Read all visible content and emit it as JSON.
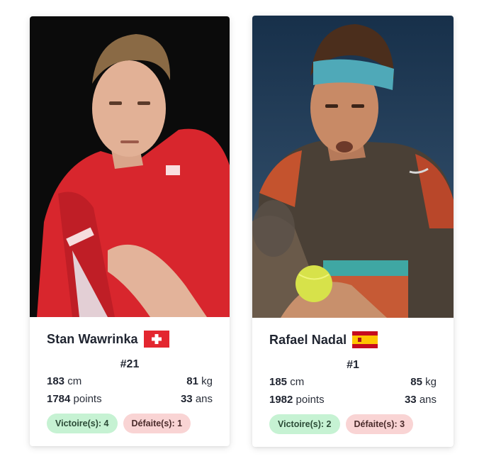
{
  "players": [
    {
      "name": "Stan Wawrinka",
      "flag": "switzerland-flag",
      "rank": "#21",
      "height_value": "183",
      "height_unit": "cm",
      "weight_value": "81",
      "weight_unit": "kg",
      "points_value": "1784",
      "points_unit": "points",
      "age_value": "33",
      "age_unit": "ans",
      "wins_label": "Victoire(s): 4",
      "losses_label": "Défaite(s): 1",
      "photo_bg": "#0b0b0b",
      "shirt_color": "#d8262d"
    },
    {
      "name": "Rafael Nadal",
      "flag": "spain-flag",
      "rank": "#1",
      "height_value": "185",
      "height_unit": "cm",
      "weight_value": "85",
      "weight_unit": "kg",
      "points_value": "1982",
      "points_unit": "points",
      "age_value": "33",
      "age_unit": "ans",
      "wins_label": "Victoire(s): 2",
      "losses_label": "Défaite(s): 3",
      "photo_bg": "#1c3550",
      "shirt_color": "#4a4036"
    }
  ],
  "colors": {
    "win_badge_bg": "#c6f2d3",
    "loss_badge_bg": "#f9d4d4",
    "text": "#1f2430"
  }
}
